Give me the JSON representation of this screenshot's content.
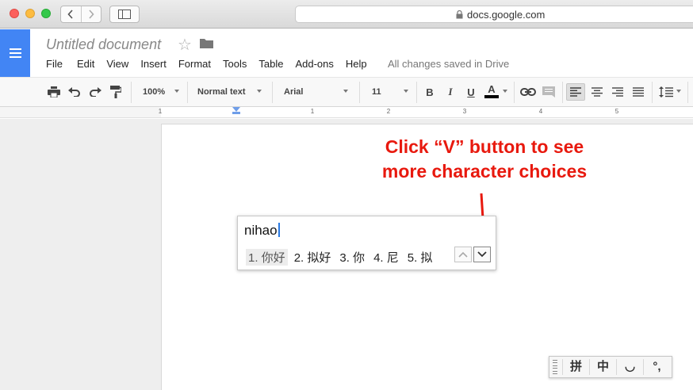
{
  "browser": {
    "url": "docs.google.com"
  },
  "document": {
    "title": "Untitled document",
    "save_status": "All changes saved in Drive"
  },
  "menu": {
    "items": [
      "File",
      "Edit",
      "View",
      "Insert",
      "Format",
      "Tools",
      "Table",
      "Add-ons",
      "Help"
    ]
  },
  "toolbar": {
    "zoom": "100%",
    "style": "Normal text",
    "font": "Arial",
    "size": "11",
    "bold": "B",
    "italic": "I",
    "underline": "U",
    "text_color": "A"
  },
  "ruler": {
    "labels": [
      "1",
      "1",
      "2",
      "3",
      "4",
      "5"
    ]
  },
  "annotation": {
    "line1": "Click “V” button to see",
    "line2": "more character choices",
    "color": "#e8190e"
  },
  "ime": {
    "composition": "nihao",
    "candidates": [
      "1. 你好",
      "2. 拟好",
      "3. 你",
      "4. 尼",
      "5. 拟"
    ],
    "status_bar": [
      "拼",
      "中",
      "◡",
      "°,"
    ]
  },
  "icons": {
    "url_lock": "lock-icon",
    "star": "star-icon",
    "folder": "folder-icon"
  }
}
